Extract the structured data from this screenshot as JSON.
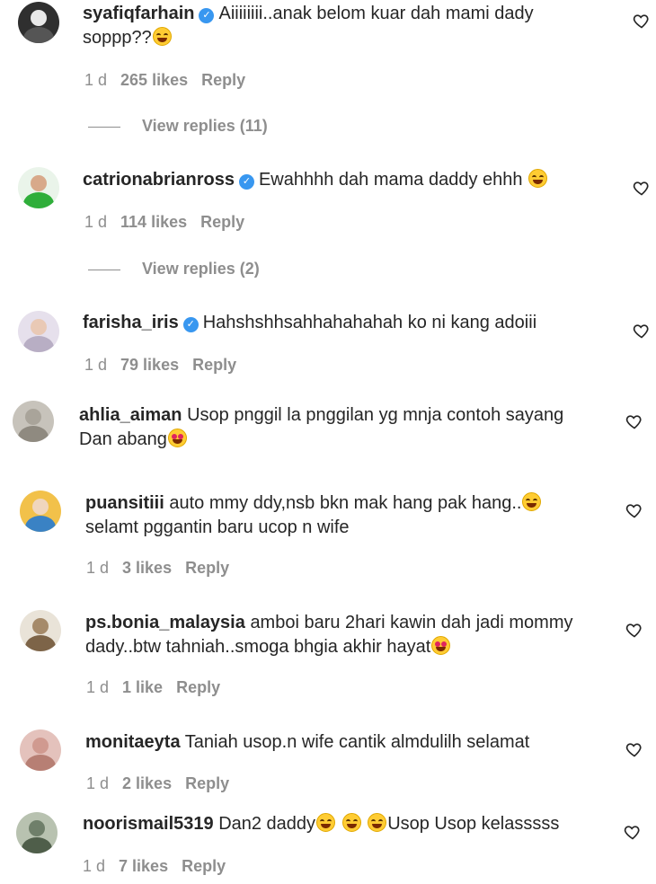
{
  "comments": [
    {
      "username": "syafiqfarhain",
      "verified": true,
      "text": "Aiiiiiiii..anak belom kuar dah mami dady soppp??",
      "emojis": [
        "joy"
      ],
      "time": "1 d",
      "likes": "265 likes",
      "reply": "Reply",
      "view_replies": "View replies (11)",
      "avatar_color": "#3a3a3a"
    },
    {
      "username": "catrionabrianross",
      "verified": true,
      "text": "Ewahhhh dah mama daddy ehhh",
      "emojis": [
        "joy"
      ],
      "time": "1 d",
      "likes": "114 likes",
      "reply": "Reply",
      "view_replies": "View replies (2)",
      "avatar_color": "#2fae3a"
    },
    {
      "username": "farisha_iris",
      "verified": true,
      "text": "Hahshshhsahhahahahah ko ni kang adoiii",
      "emojis": [],
      "time": "1 d",
      "likes": "79 likes",
      "reply": "Reply",
      "avatar_color": "#c9bfd2"
    },
    {
      "username": "ahlia_aiman",
      "verified": false,
      "text": "Usop pnggil la pnggilan yg mnja contoh sayang Dan abang",
      "emojis": [
        "heart_eyes"
      ],
      "avatar_color": "#b9b5ad"
    },
    {
      "username": "puansitiii",
      "verified": false,
      "text_before": "auto mmy ddy,nsb bkn mak hang pak hang..",
      "text_after": "selamt pggantin baru ucop n wife",
      "emojis": [
        "rofl"
      ],
      "time": "1 d",
      "likes": "3 likes",
      "reply": "Reply",
      "avatar_color": "#e7a23a"
    },
    {
      "username": "ps.bonia_malaysia",
      "verified": false,
      "text": "amboi baru 2hari kawin dah jadi mommy dady..btw tahniah..smoga bhgia akhir hayat",
      "emojis": [
        "heart_eyes"
      ],
      "time": "1 d",
      "likes": "1 like",
      "reply": "Reply",
      "avatar_color": "#a58a6a"
    },
    {
      "username": "monitaeyta",
      "verified": false,
      "text": "Taniah usop.n wife cantik almdulilh selamat",
      "emojis": [],
      "time": "1 d",
      "likes": "2 likes",
      "reply": "Reply",
      "avatar_color": "#d5a8a0"
    },
    {
      "username": "noorismail5319",
      "verified": false,
      "text_before": "Dan2 daddy",
      "text_after": "Usop Usop kelasssss",
      "emojis": [
        "joy",
        "joy",
        "joy"
      ],
      "time": "1 d",
      "likes": "7 likes",
      "reply": "Reply",
      "avatar_color": "#6f7f6a"
    }
  ],
  "colors": {
    "text": "#262626",
    "muted": "#8e8e8e",
    "verified": "#3897f0",
    "bg": "#ffffff"
  },
  "icons": {
    "like": "heart-outline-icon",
    "verified": "verified-badge-icon"
  }
}
